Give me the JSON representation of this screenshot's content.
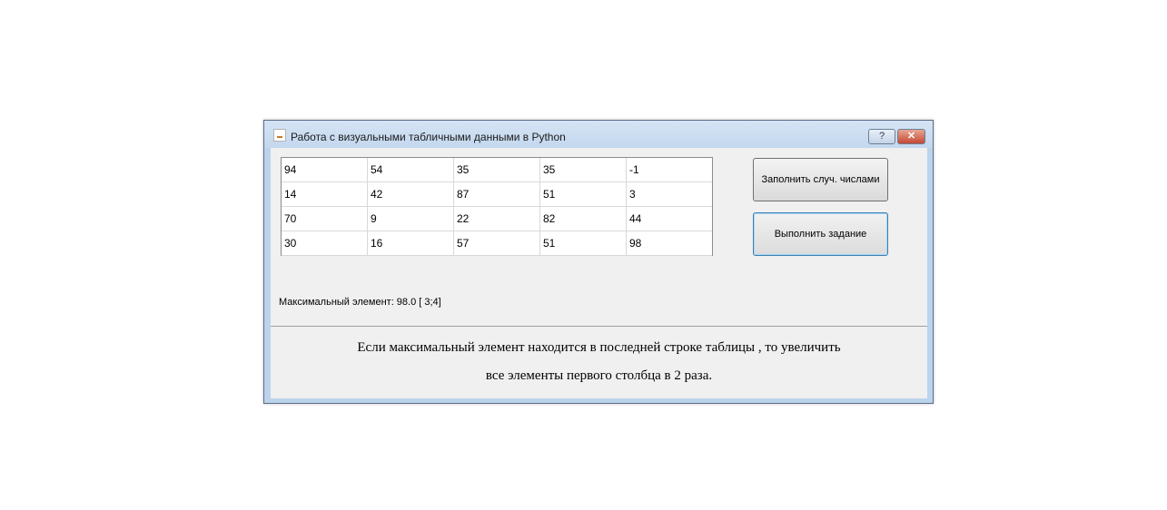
{
  "window": {
    "title": "Работа с визуальными табличными данными в Python",
    "help_label": "?",
    "close_label": "✕"
  },
  "table": {
    "rows": [
      [
        "94",
        "54",
        "35",
        "35",
        "-1"
      ],
      [
        "14",
        "42",
        "87",
        "51",
        "3"
      ],
      [
        "70",
        "9",
        "22",
        "82",
        "44"
      ],
      [
        "30",
        "16",
        "57",
        "51",
        "98"
      ]
    ]
  },
  "buttons": {
    "fill_label": "Заполнить случ. числами",
    "run_label": "Выполнить задание"
  },
  "result": {
    "max_label": "Максимальный элемент: 98.0 [ 3;4]"
  },
  "task": {
    "line1": "Если максимальный элемент находится в последней строке таблицы , то увеличить",
    "line2": "все элементы первого столбца в 2 раза."
  }
}
